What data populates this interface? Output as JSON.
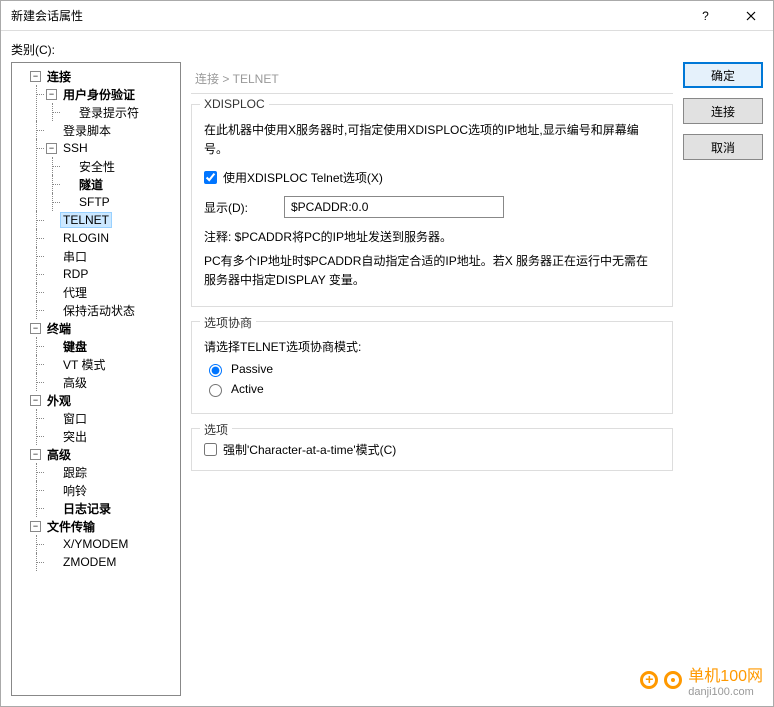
{
  "window": {
    "title": "新建会话属性"
  },
  "category_label": "类别(C):",
  "tree": {
    "connection": "连接",
    "auth": "用户身份验证",
    "login_prompt": "登录提示符",
    "login_script": "登录脚本",
    "ssh": "SSH",
    "security": "安全性",
    "tunnel": "隧道",
    "sftp": "SFTP",
    "telnet": "TELNET",
    "rlogin": "RLOGIN",
    "serial": "串口",
    "rdp": "RDP",
    "proxy": "代理",
    "keepalive": "保持活动状态",
    "terminal": "终端",
    "keyboard": "键盘",
    "vtmode": "VT 模式",
    "term_adv": "高级",
    "appearance": "外观",
    "win": "窗口",
    "popup": "突出",
    "advanced": "高级",
    "trace": "跟踪",
    "bell": "响铃",
    "log": "日志记录",
    "ft": "文件传输",
    "xym": "X/YMODEM",
    "zm": "ZMODEM"
  },
  "breadcrumb": "连接  >  TELNET",
  "xdisploc": {
    "legend": "XDISPLOC",
    "desc": "在此机器中使用X服务器时,可指定使用XDISPLOC选项的IP地址,显示编号和屏幕编号。",
    "use_label": "使用XDISPLOC Telnet选项(X)",
    "display_label": "显示(D):",
    "display_value": "$PCADDR:0.0",
    "note1": "注释: $PCADDR将PC的IP地址发送到服务器。",
    "note2": "PC有多个IP地址时$PCADDR自动指定合适的IP地址。若X 服务器正在运行中无需在服务器中指定DISPLAY 变量。"
  },
  "negotiation": {
    "legend": "选项协商",
    "prompt": "请选择TELNET选项协商模式:",
    "passive": "Passive",
    "active": "Active"
  },
  "options": {
    "legend": "选项",
    "force_cat": "强制'Character-at-a-time'模式(C)"
  },
  "buttons": {
    "ok": "确定",
    "connect": "连接",
    "cancel": "取消"
  },
  "watermark": {
    "brand": "单机100网",
    "url": "danji100.com"
  }
}
